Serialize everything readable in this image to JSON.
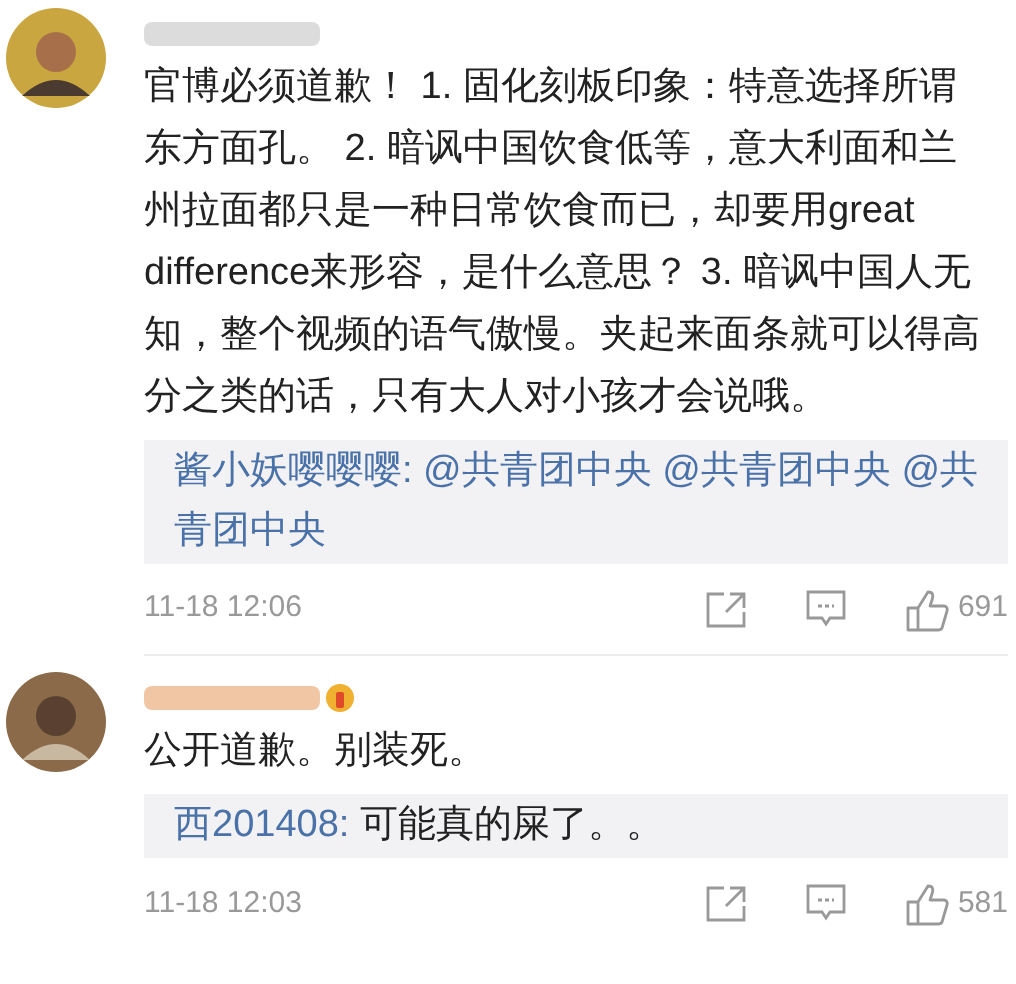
{
  "comments": [
    {
      "badge": false,
      "text": "官博必须道歉！ 1. 固化刻板印象：特意选择所谓东方面孔。 2. 暗讽中国饮食低等，意大利面和兰州拉面都只是一种日常饮食而已，却要用great difference来形容，是什么意思？ 3. 暗讽中国人无知，整个视频的语气傲慢。夹起来面条就可以得高分之类的话，只有大人对小孩才会说哦。",
      "reply": {
        "author": "酱小妖嘤嘤嘤:",
        "text": "@共青团中央 @共青团中央 @共青团中央",
        "mentions": true
      },
      "time": "11-18 12:06",
      "likes": "691"
    },
    {
      "badge": true,
      "text": "公开道歉。别装死。",
      "reply": {
        "author": "西201408:",
        "text": "可能真的屎了。。",
        "mentions": false
      },
      "time": "11-18 12:03",
      "likes": "581"
    }
  ]
}
